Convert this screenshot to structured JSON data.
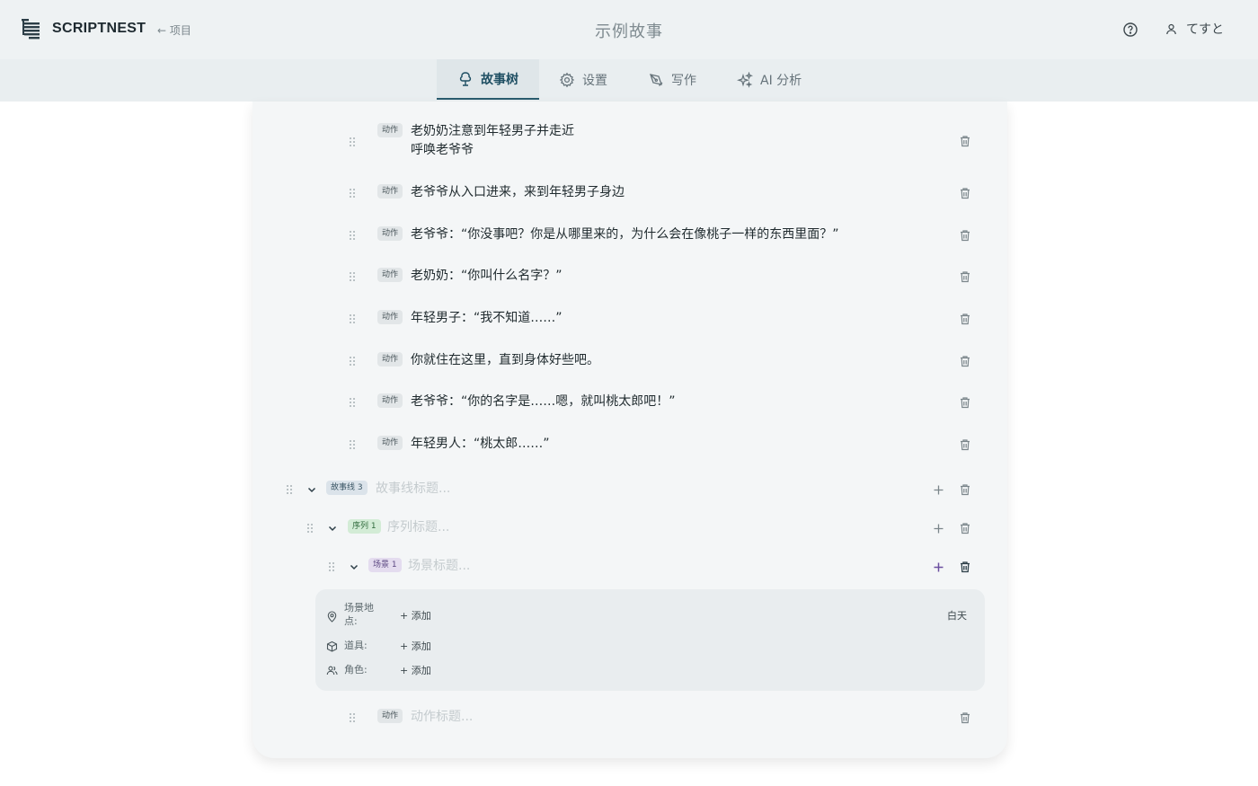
{
  "header": {
    "brand": "SCRIPTNEST",
    "back_label": "← 项目",
    "page_title": "示例故事",
    "user_name": "てすと"
  },
  "tabs": [
    {
      "label": "故事树",
      "icon": "tree-icon",
      "active": true
    },
    {
      "label": "设置",
      "icon": "gear-icon",
      "active": false
    },
    {
      "label": "写作",
      "icon": "pen-icon",
      "active": false
    },
    {
      "label": "AI 分析",
      "icon": "sparkles-icon",
      "active": false
    }
  ],
  "actions": [
    {
      "badge": "动作",
      "line1": "老奶奶注意到年轻男子并走近",
      "line2": "呼唤老爷爷"
    },
    {
      "badge": "动作",
      "line1": "老爷爷从入口进来，来到年轻男子身边"
    },
    {
      "badge": "动作",
      "line1": "老爷爷：“你没事吧？你是从哪里来的，为什么会在像桃子一样的东西里面？”"
    },
    {
      "badge": "动作",
      "line1": "老奶奶：“你叫什么名字？”"
    },
    {
      "badge": "动作",
      "line1": "年轻男子：“我不知道……”"
    },
    {
      "badge": "动作",
      "line1": "你就住在这里，直到身体好些吧。"
    },
    {
      "badge": "动作",
      "line1": "老爷爷：“你的名字是……嗯，就叫桃太郎吧！”"
    },
    {
      "badge": "动作",
      "line1": "年轻男人：“桃太郎……”"
    }
  ],
  "storyline": {
    "badge": "故事线 3",
    "placeholder": "故事线标题..."
  },
  "sequence": {
    "badge": "序列 1",
    "placeholder": "序列标题..."
  },
  "scene": {
    "badge": "场景 1",
    "placeholder": "场景标题...",
    "location_label": "场景地点:",
    "props_label": "道具:",
    "characters_label": "角色:",
    "add_label": "+ 添加",
    "time_of_day": "白天"
  },
  "new_action": {
    "badge": "动作",
    "placeholder": "动作标题..."
  },
  "colors": {
    "header_bg": "#eef2f3",
    "tab_active": "#2a5b6e",
    "card_bg": "#f4f6f7",
    "scene_plus": "#6b4fa0"
  }
}
